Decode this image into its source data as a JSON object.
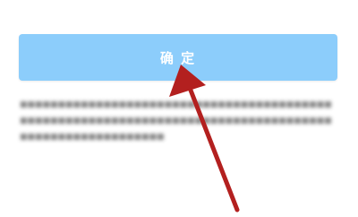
{
  "confirm_button": {
    "label": "确 定"
  },
  "notice": {
    "text": "■■■■■■■■■■■■■■■■■■■■■■■■■■■■■■■■■■■■■■■■■■■■■■■■■■■■■■■■■■■■■■■■■■■■■■■■■■■■■■■■■■■■■■■■■■■■■■■■■■■■■"
  },
  "colors": {
    "button_background": "#8ccdfb",
    "arrow": "#b3201f"
  },
  "icons": {
    "annotation": "red-arrow-pointer-icon"
  }
}
